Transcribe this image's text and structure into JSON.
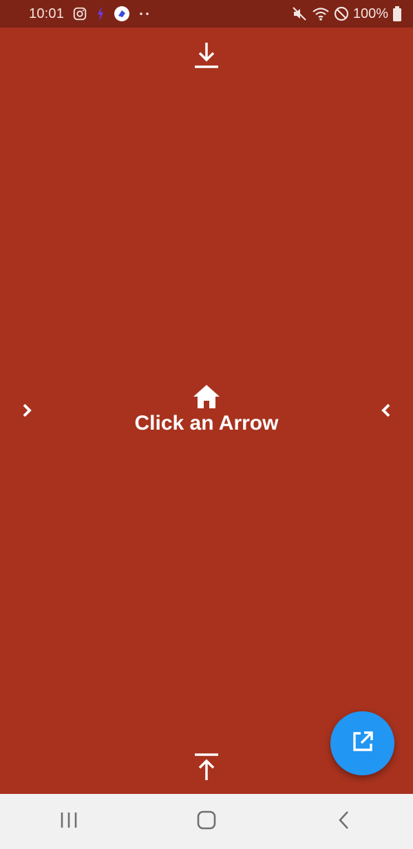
{
  "status_bar": {
    "time": "10:01",
    "battery_text": "100%",
    "icons": [
      "instagram-icon",
      "bolt-icon",
      "app-icon",
      "more-dots-icon",
      "mute-icon",
      "wifi-icon",
      "do-not-disturb-icon",
      "battery-icon"
    ]
  },
  "main": {
    "title": "Click an Arrow",
    "icons": {
      "top": "arrow-downward-icon",
      "bottom": "arrow-upward-icon",
      "left": "chevron-right-icon",
      "right": "chevron-left-icon",
      "center": "home-icon"
    },
    "background_color": "#a8321e"
  },
  "fab": {
    "icon": "open-in-new-icon",
    "color": "#2196f3"
  },
  "nav_bar": {
    "buttons": [
      "recent-apps-icon",
      "home-button-icon",
      "back-icon"
    ]
  }
}
